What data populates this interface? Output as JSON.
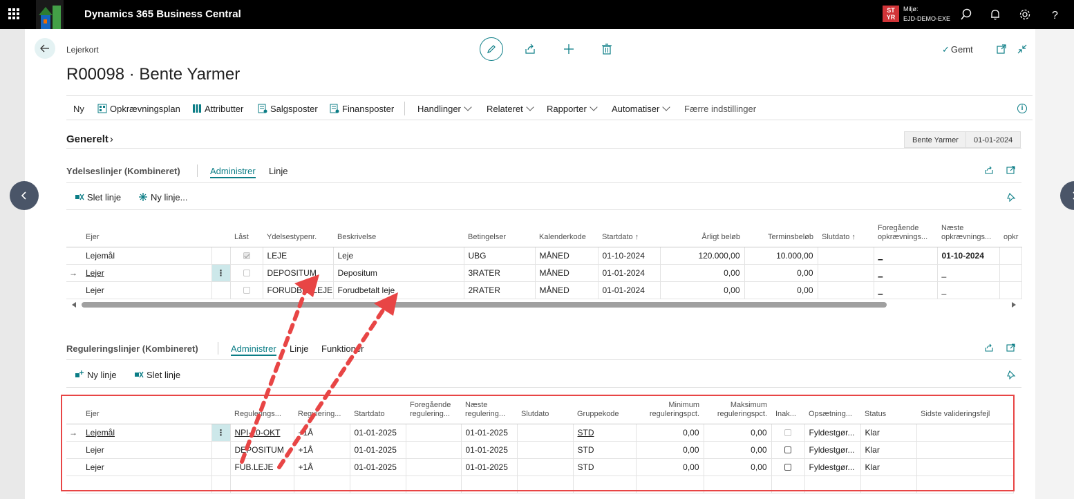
{
  "topbar": {
    "app_title": "Dynamics 365 Business Central",
    "env_badge": "ST YR",
    "env_label": "Miljø:",
    "env_name": "EJD-DEMO-EXE"
  },
  "header": {
    "breadcrumb": "Lejerkort",
    "title": "R00098 · Bente Yarmer",
    "saved_label": "Gemt"
  },
  "actions": {
    "ny": "Ny",
    "opkraevningsplan": "Opkrævningsplan",
    "attributter": "Attributter",
    "salgsposter": "Salgsposter",
    "finansposter": "Finansposter",
    "handlinger": "Handlinger",
    "relateret": "Relateret",
    "rapporter": "Rapporter",
    "automatiser": "Automatiser",
    "faerre": "Færre indstillinger"
  },
  "general": {
    "title": "Generelt",
    "tags": [
      "Bente Yarmer",
      "01-01-2024"
    ]
  },
  "ydelse": {
    "title": "Ydelseslinjer (Kombineret)",
    "tabs": [
      "Administrer",
      "Linje"
    ],
    "sub_actions": [
      "Slet linje",
      "Ny linje..."
    ],
    "columns": {
      "ejer": "Ejer",
      "laast": "Låst",
      "ydelsestypenr": "Ydelsestypenr.",
      "beskrivelse": "Beskrivelse",
      "betingelser": "Betingelser",
      "kalenderkode": "Kalenderkode",
      "startdato": "Startdato ↑",
      "aarligt": "Årligt beløb",
      "termins": "Terminsbeløb",
      "slutdato": "Slutdato ↑",
      "foregaaende_1": "Foregående",
      "foregaaende_2": "opkrævnings...",
      "naeste_1": "Næste",
      "naeste_2": "opkrævnings...",
      "opkr": "opkr"
    },
    "rows": [
      {
        "ejer": "Lejemål",
        "ydelse": "LEJE",
        "beskrivelse": "Leje",
        "betingelser": "UBG",
        "kalender": "MÅNED",
        "start": "01-10-2024",
        "aarligt": "120.000,00",
        "termins": "10.000,00",
        "foreg": "_",
        "naeste": "01-10-2024"
      },
      {
        "ejer": "Lejer",
        "ydelse": "DEPOSITUM",
        "beskrivelse": "Depositum",
        "betingelser": "3RATER",
        "kalender": "MÅNED",
        "start": "01-01-2024",
        "aarligt": "0,00",
        "termins": "0,00",
        "foreg": "_",
        "naeste": "_"
      },
      {
        "ejer": "Lejer",
        "ydelse": "FORUDBETLEJE",
        "beskrivelse": "Forudbetalt leje",
        "betingelser": "2RATER",
        "kalender": "MÅNED",
        "start": "01-01-2024",
        "aarligt": "0,00",
        "termins": "0,00",
        "foreg": "_",
        "naeste": "_"
      }
    ]
  },
  "regulering": {
    "title": "Reguleringslinjer (Kombineret)",
    "tabs": [
      "Administrer",
      "Linje",
      "Funktioner"
    ],
    "sub_actions": [
      "Ny linje",
      "Slet linje"
    ],
    "columns": {
      "ejer": "Ejer",
      "reg1": "Regulerings...",
      "reg2": "Regulering...",
      "startdato": "Startdato",
      "foreg_1": "Foregående",
      "foreg_2": "regulering...",
      "naeste_1": "Næste",
      "naeste_2": "regulering...",
      "slutdato": "Slutdato",
      "gruppekode": "Gruppekode",
      "min_1": "Minimum",
      "min_2": "reguleringspct.",
      "max_1": "Maksimum",
      "max_2": "reguleringspct.",
      "inak": "Inak...",
      "opsaetning": "Opsætning...",
      "status": "Status",
      "fejl": "Sidste valideringsfejl"
    },
    "rows": [
      {
        "ejer": "Lejemål",
        "reg1": "NPI-10-OKT",
        "reg2": "+1Å",
        "start": "01-01-2025",
        "naeste": "01-01-2025",
        "gruppe": "STD",
        "min": "0,00",
        "max": "0,00",
        "ops": "Fyldestgør...",
        "status": "Klar"
      },
      {
        "ejer": "Lejer",
        "reg1": "DEPOSITUM",
        "reg2": "+1Å",
        "start": "01-01-2025",
        "naeste": "01-01-2025",
        "gruppe": "STD",
        "min": "0,00",
        "max": "0,00",
        "ops": "Fyldestgør...",
        "status": "Klar"
      },
      {
        "ejer": "Lejer",
        "reg1": "FUB.LEJE",
        "reg2": "+1Å",
        "start": "01-01-2025",
        "naeste": "01-01-2025",
        "gruppe": "STD",
        "min": "0,00",
        "max": "0,00",
        "ops": "Fyldestgør...",
        "status": "Klar"
      }
    ]
  },
  "colors": {
    "accent": "#0b7d86",
    "annotation": "#e84545",
    "env_badge": "#d13438"
  }
}
